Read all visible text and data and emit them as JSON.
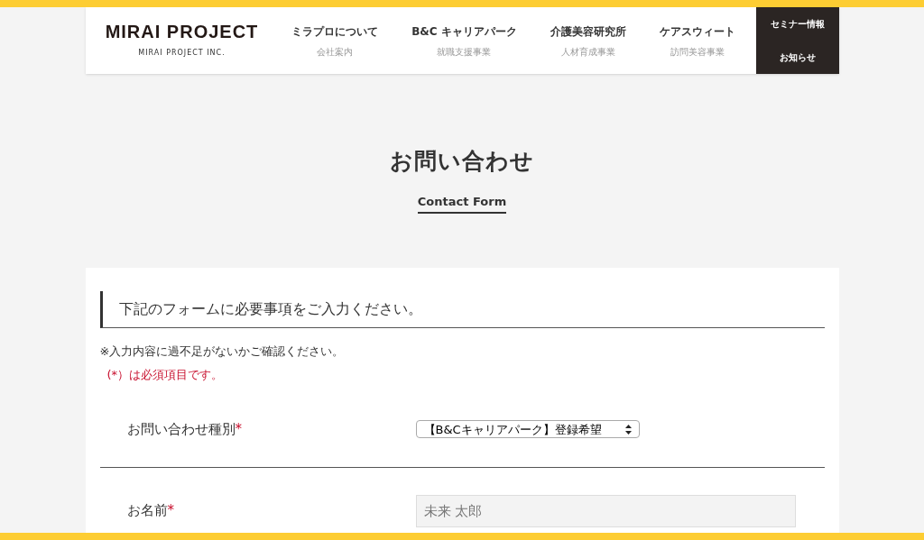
{
  "header": {
    "logo": {
      "title": "MIRAI PROJECT",
      "subtitle": "MIRAI PROJECT INC."
    },
    "nav": [
      {
        "label": "ミラプロについて",
        "sub": "会社案内"
      },
      {
        "label": "B&C キャリアパーク",
        "sub": "就職支援事業"
      },
      {
        "label": "介護美容研究所",
        "sub": "人材育成事業"
      },
      {
        "label": "ケアスウィート",
        "sub": "訪問美容事業"
      }
    ],
    "side_links": [
      "セミナー情報",
      "お知らせ"
    ]
  },
  "page_title": "お問い合わせ",
  "page_subtitle": "Contact Form",
  "form": {
    "heading": "下記のフォームに必要事項をご入力ください。",
    "note": "※入力内容に過不足がないかご確認ください。",
    "required_note": "(*）は必須項目です。",
    "fields": [
      {
        "kind": "select",
        "label": "お問い合わせ種別",
        "mark": "*",
        "value": "【B&Cキャリアパーク】登録希望"
      },
      {
        "kind": "text",
        "label": "お名前",
        "mark": "*",
        "placeholder": "未来 太郎"
      }
    ]
  }
}
